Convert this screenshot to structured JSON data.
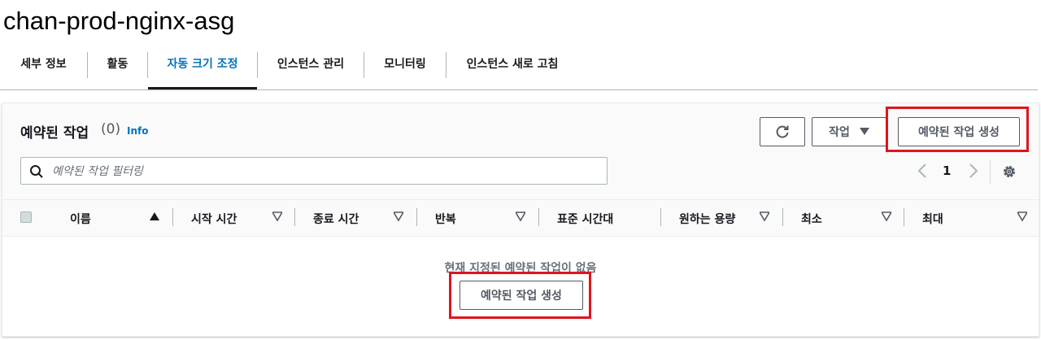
{
  "page": {
    "title": "chan-prod-nginx-asg"
  },
  "tabs": [
    {
      "label": "세부 정보",
      "active": false
    },
    {
      "label": "활동",
      "active": false
    },
    {
      "label": "자동 크기 조정",
      "active": true
    },
    {
      "label": "인스턴스 관리",
      "active": false
    },
    {
      "label": "모니터링",
      "active": false
    },
    {
      "label": "인스턴스 새로 고침",
      "active": false
    }
  ],
  "panel": {
    "title": "예약된 작업",
    "count": "(0)",
    "info_label": "Info",
    "actions_label": "작업",
    "create_label": "예약된 작업 생성",
    "icons": {
      "refresh": "refresh-icon",
      "actions": "caret-down-icon",
      "search": "search-icon",
      "settings": "gear-icon"
    }
  },
  "search": {
    "placeholder": "예약된 작업 필터링",
    "value": ""
  },
  "pagination": {
    "current_page": "1"
  },
  "table": {
    "columns": [
      {
        "label": "이름",
        "sort": "ascending"
      },
      {
        "label": "시작 시간",
        "sort": "none"
      },
      {
        "label": "종료 시간",
        "sort": "none"
      },
      {
        "label": "반복",
        "sort": "none"
      },
      {
        "label": "표준 시간대",
        "sort": "none"
      },
      {
        "label": "원하는 용량",
        "sort": "none"
      },
      {
        "label": "최소",
        "sort": "none"
      },
      {
        "label": "최대",
        "sort": "none"
      }
    ],
    "empty_message": "현재 지정된 예약된 작업이 없음",
    "empty_create_label": "예약된 작업 생성",
    "rows": []
  },
  "colors": {
    "accent_link": "#0073bb",
    "highlight_box": "#e0141e",
    "text_primary": "#16191f",
    "border": "#545b64"
  }
}
